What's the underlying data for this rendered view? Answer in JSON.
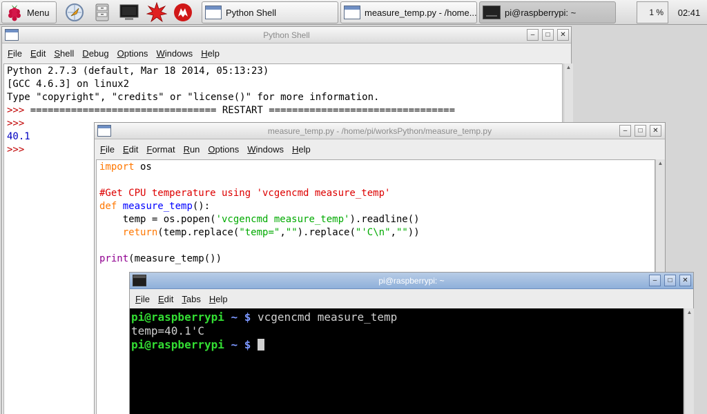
{
  "taskbar": {
    "menu_label": "Menu",
    "tasks": [
      {
        "label": "Python Shell"
      },
      {
        "label": "measure_temp.py - /home..."
      },
      {
        "label": "pi@raspberrypi: ~"
      }
    ],
    "cpu": "1 %",
    "clock": "02:41"
  },
  "shell": {
    "title": "Python Shell",
    "menu": [
      "File",
      "Edit",
      "Shell",
      "Debug",
      "Options",
      "Windows",
      "Help"
    ],
    "lines": {
      "l1": "Python 2.7.3 (default, Mar 18 2014, 05:13:23)",
      "l2": "[GCC 4.6.3] on linux2",
      "l3": "Type \"copyright\", \"credits\" or \"license()\" for more information.",
      "l4_prompt": ">>> ",
      "l4_text": "================================ RESTART ================================",
      "l5_prompt": ">>>",
      "l6_output": "40.1",
      "l7_prompt": ">>>"
    }
  },
  "editor": {
    "title": "measure_temp.py - /home/pi/worksPython/measure_temp.py",
    "menu": [
      "File",
      "Edit",
      "Format",
      "Run",
      "Options",
      "Windows",
      "Help"
    ],
    "code": {
      "import_kw": "import",
      "import_rest": " os",
      "comment": "#Get CPU temperature using 'vcgencmd measure_temp'",
      "def_kw": "def",
      "def_name": " measure_temp",
      "def_rest": "():",
      "l4_a": "    temp = os.popen(",
      "l4_str": "'vcgencmd measure_temp'",
      "l4_b": ").readline()",
      "l5_indent": "    ",
      "return_kw": "return",
      "l5_a": "(temp.replace(",
      "l5_s1": "\"temp=\"",
      "l5_b": ",",
      "l5_s2": "\"\"",
      "l5_c": ").replace(",
      "l5_s3": "\"'C\\n\"",
      "l5_d": ",",
      "l5_s4": "\"\"",
      "l5_e": "))",
      "print_kw": "print",
      "print_rest": "(measure_temp())"
    }
  },
  "terminal": {
    "title": "pi@raspberrypi: ~",
    "menu": [
      "File",
      "Edit",
      "Tabs",
      "Help"
    ],
    "user": "pi@raspberrypi",
    "path": " ~ $",
    "command": " vcgencmd measure_temp",
    "output": "temp=40.1'C"
  }
}
